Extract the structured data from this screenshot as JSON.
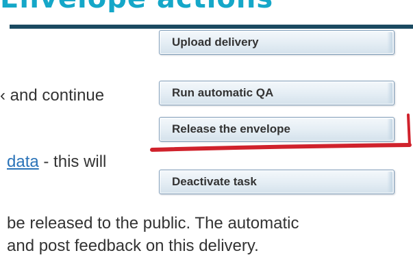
{
  "colors": {
    "heading": "#15a7c8",
    "rule": "#1a4a61",
    "link": "#2a73b8",
    "annotation": "#d0222c",
    "button_border": "#7f9db9"
  },
  "heading": {
    "fragment": "Envelope actions"
  },
  "actions": {
    "upload_label": "Upload delivery",
    "qa_label": "Run automatic QA",
    "release_label": "Release the envelope",
    "deactivate_label": "Deactivate task"
  },
  "side": {
    "continue_text": "‹ and continue",
    "data_link": "data",
    "data_rest": " - this will"
  },
  "paragraph": {
    "line1": "be released to the public. The automatic",
    "line2": "and post feedback on this delivery."
  },
  "annotation": {
    "type": "red-underline"
  }
}
